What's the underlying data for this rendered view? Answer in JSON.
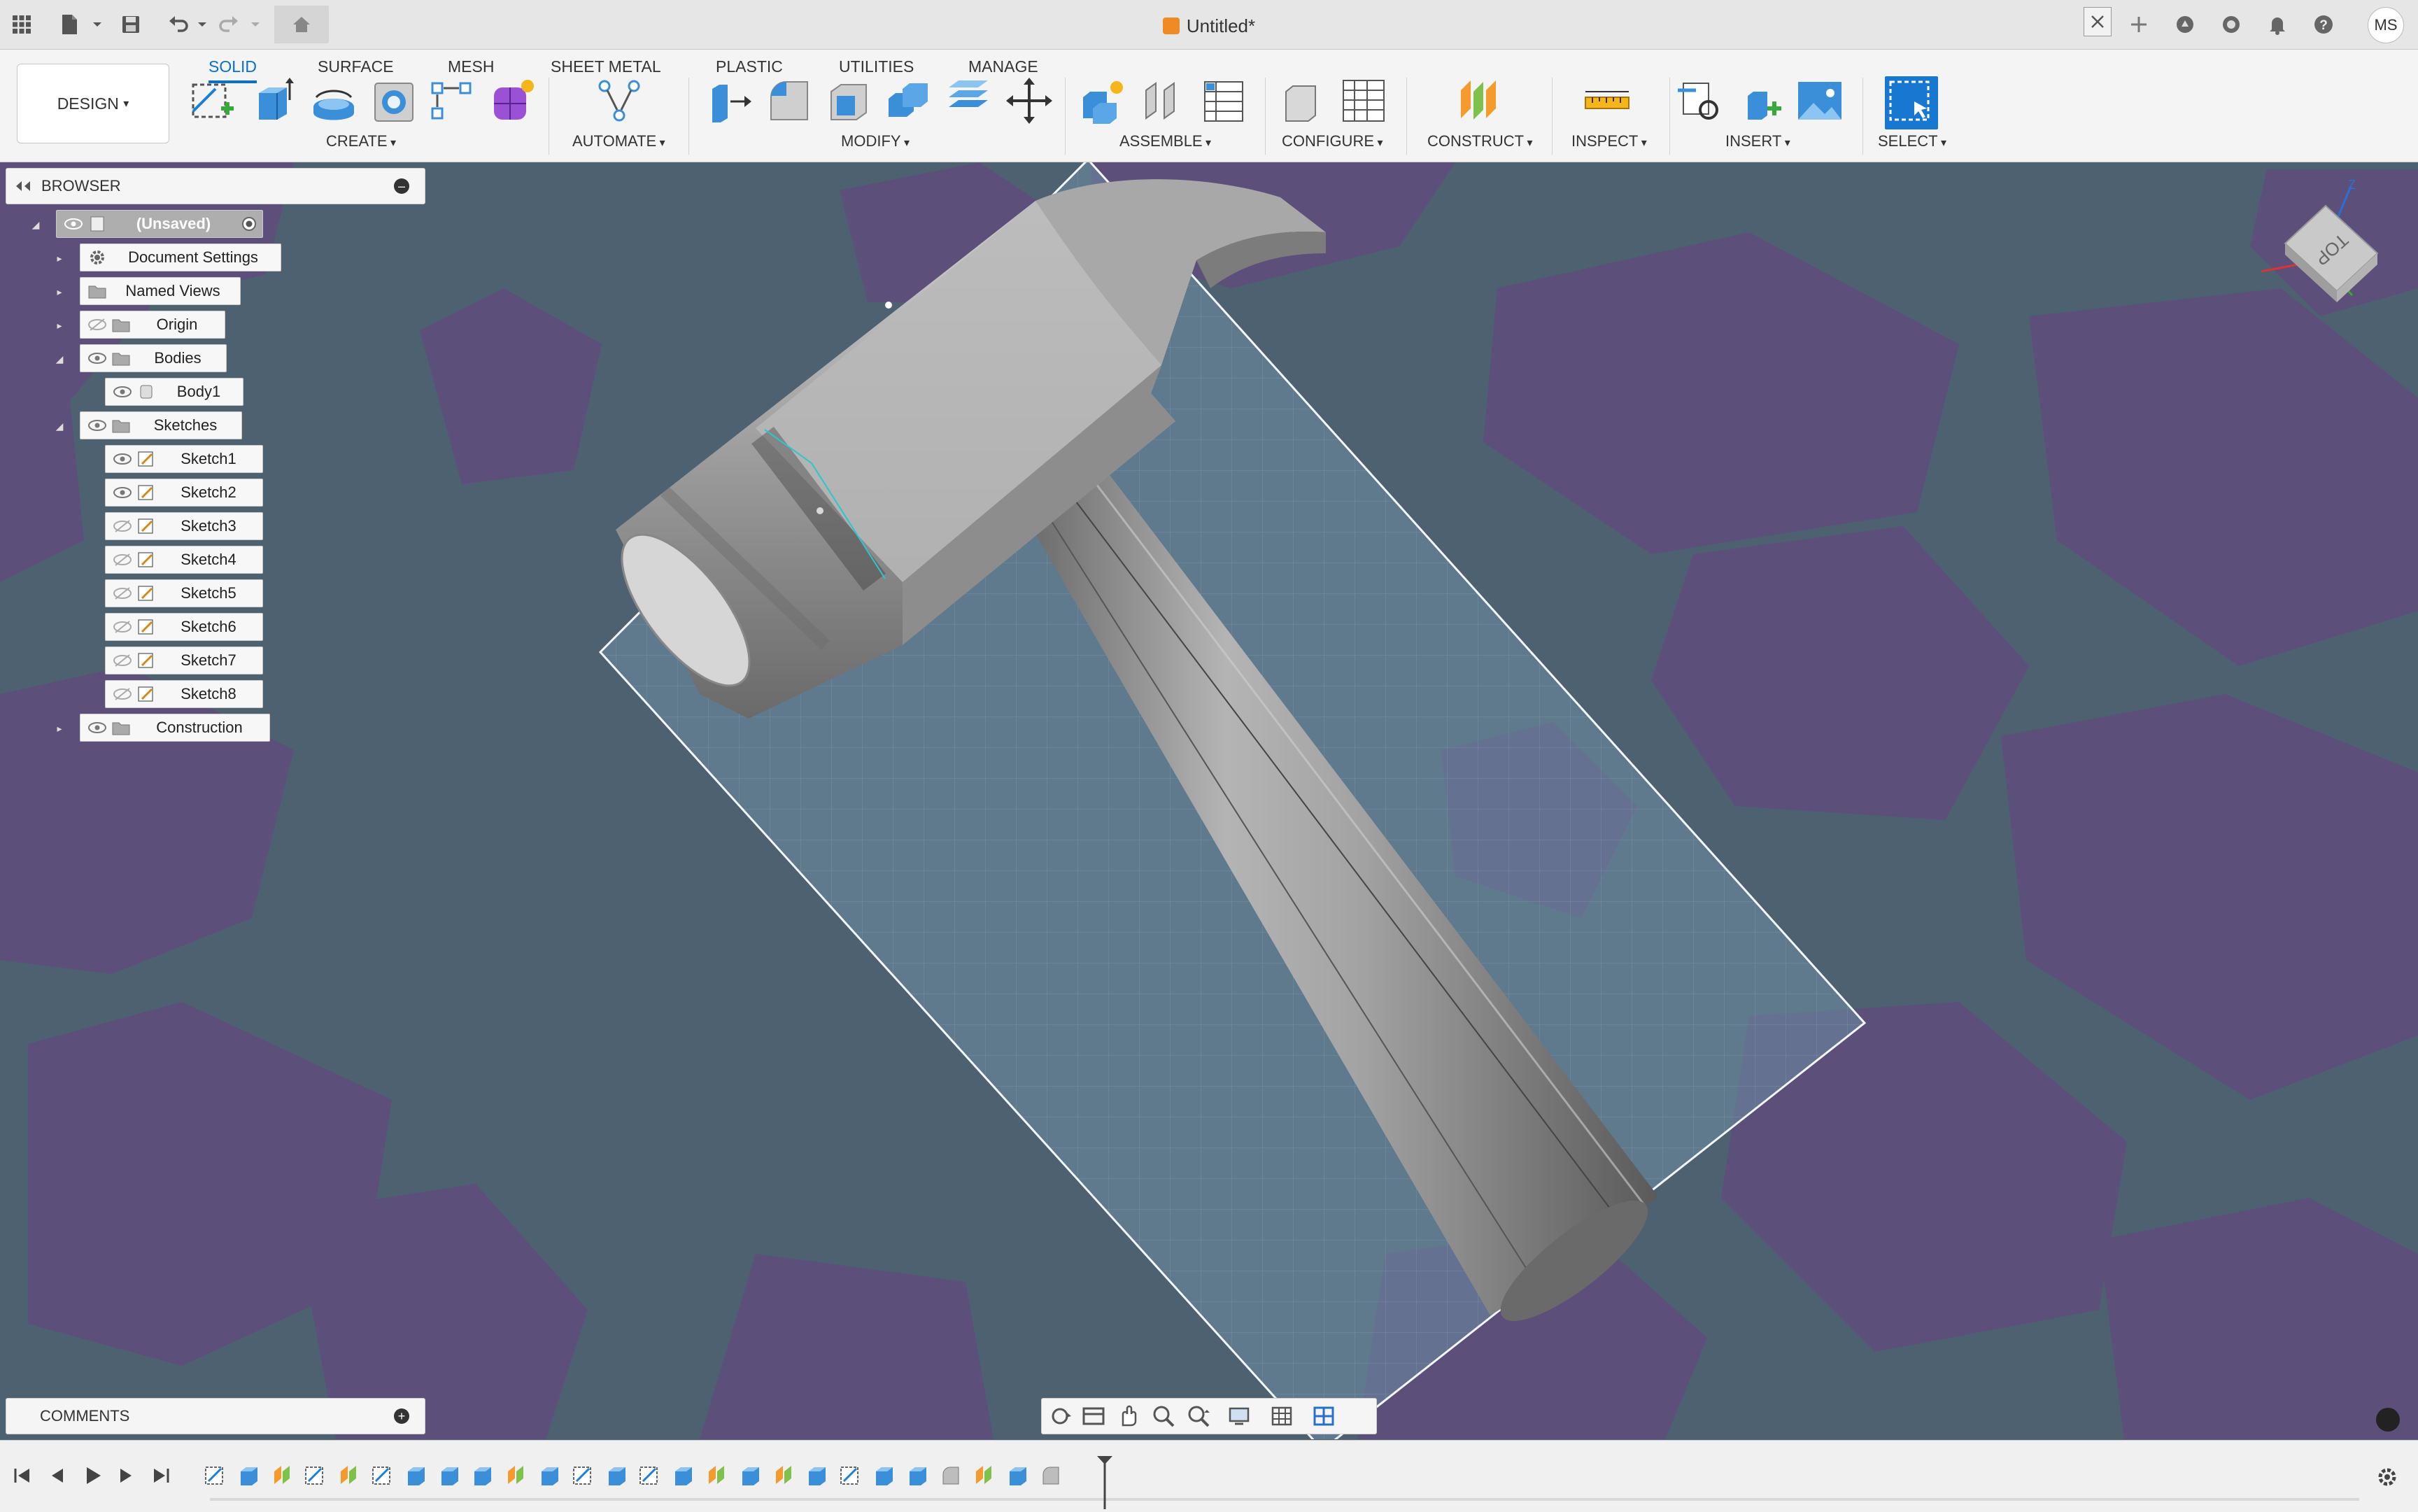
{
  "titlebar": {
    "document_title": "Untitled*",
    "user_initials": "MS"
  },
  "ribbon": {
    "workspace": "DESIGN",
    "tabs": [
      {
        "label": "SOLID",
        "active": true
      },
      {
        "label": "SURFACE"
      },
      {
        "label": "MESH"
      },
      {
        "label": "SHEET METAL"
      },
      {
        "label": "PLASTIC"
      },
      {
        "label": "UTILITIES"
      },
      {
        "label": "MANAGE"
      }
    ],
    "groups": {
      "create": "CREATE",
      "automate": "AUTOMATE",
      "modify": "MODIFY",
      "assemble": "ASSEMBLE",
      "configure": "CONFIGURE",
      "construct": "CONSTRUCT",
      "inspect": "INSPECT",
      "insert": "INSERT",
      "select": "SELECT"
    }
  },
  "browser": {
    "title": "BROWSER",
    "root": "(Unsaved)",
    "items": {
      "document_settings": "Document Settings",
      "named_views": "Named Views",
      "origin": "Origin",
      "bodies": "Bodies",
      "body1": "Body1",
      "sketches": "Sketches",
      "construction": "Construction"
    },
    "sketches": [
      "Sketch1",
      "Sketch2",
      "Sketch3",
      "Sketch4",
      "Sketch5",
      "Sketch6",
      "Sketch7",
      "Sketch8"
    ]
  },
  "comments": {
    "title": "COMMENTS"
  },
  "viewcube": {
    "face": "TOP"
  },
  "colors": {
    "accent": "#0a6ed1",
    "viewport_bg": "#4e6170",
    "viewport_pattern": "#5c4f79",
    "sketch_plane": "#6e8ea5",
    "body_gray": "#9a9a9a"
  }
}
